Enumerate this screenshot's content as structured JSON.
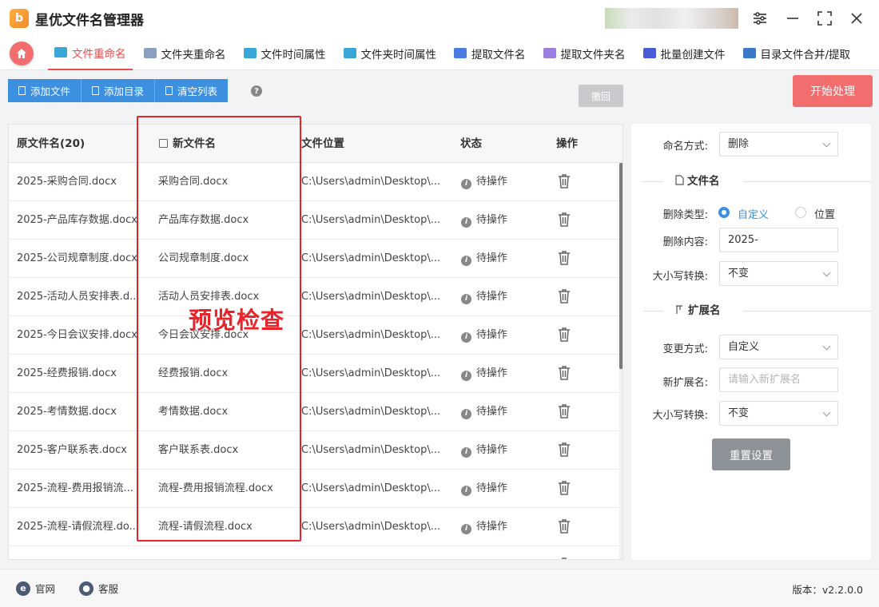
{
  "app": {
    "title": "星优文件名管理器",
    "logo_text": "b"
  },
  "tabs": [
    {
      "label": "文件重命名",
      "color": "#3aa6d8",
      "active": true
    },
    {
      "label": "文件夹重命名",
      "color": "#8aa0bf",
      "active": false
    },
    {
      "label": "文件时间属性",
      "color": "#3aa6d8",
      "active": false
    },
    {
      "label": "文件夹时间属性",
      "color": "#3aa6d8",
      "active": false
    },
    {
      "label": "提取文件名",
      "color": "#4a7be0",
      "active": false
    },
    {
      "label": "提取文件夹名",
      "color": "#9a7ee0",
      "active": false
    },
    {
      "label": "批量创建文件",
      "color": "#4a5bd8",
      "active": false
    },
    {
      "label": "目录文件合并/提取",
      "color": "#3a78c8",
      "active": false
    }
  ],
  "toolbar": {
    "add_file": "添加文件",
    "add_dir": "添加目录",
    "clear_list": "清空列表",
    "help": "?",
    "undo": "撤回",
    "start": "开始处理"
  },
  "table": {
    "headers": {
      "original": "原文件名(20)",
      "new_name": "新文件名",
      "location": "文件位置",
      "status": "状态",
      "action": "操作"
    },
    "rows": [
      {
        "original": "2025-采购合同.docx",
        "new_name": "采购合同.docx",
        "location": "C:\\Users\\admin\\Desktop\\...",
        "status": "待操作"
      },
      {
        "original": "2025-产品库存数据.docx",
        "new_name": "产品库存数据.docx",
        "location": "C:\\Users\\admin\\Desktop\\...",
        "status": "待操作"
      },
      {
        "original": "2025-公司规章制度.docx",
        "new_name": "公司规章制度.docx",
        "location": "C:\\Users\\admin\\Desktop\\...",
        "status": "待操作"
      },
      {
        "original": "2025-活动人员安排表.d...",
        "new_name": "活动人员安排表.docx",
        "location": "C:\\Users\\admin\\Desktop\\...",
        "status": "待操作"
      },
      {
        "original": "2025-今日会议安排.docx",
        "new_name": "今日会议安排.docx",
        "location": "C:\\Users\\admin\\Desktop\\...",
        "status": "待操作"
      },
      {
        "original": "2025-经费报销.docx",
        "new_name": "经费报销.docx",
        "location": "C:\\Users\\admin\\Desktop\\...",
        "status": "待操作"
      },
      {
        "original": "2025-考情数据.docx",
        "new_name": "考情数据.docx",
        "location": "C:\\Users\\admin\\Desktop\\...",
        "status": "待操作"
      },
      {
        "original": "2025-客户联系表.docx",
        "new_name": "客户联系表.docx",
        "location": "C:\\Users\\admin\\Desktop\\...",
        "status": "待操作"
      },
      {
        "original": "2025-流程-费用报销流...",
        "new_name": "流程-费用报销流程.docx",
        "location": "C:\\Users\\admin\\Desktop\\...",
        "status": "待操作"
      },
      {
        "original": "2025-流程-请假流程.do...",
        "new_name": "流程-请假流程.docx",
        "location": "C:\\Users\\admin\\Desktop\\...",
        "status": "待操作"
      }
    ]
  },
  "annotation": "预览检查",
  "side": {
    "naming_mode_label": "命名方式:",
    "naming_mode_value": "删除",
    "filename_section": "文件名",
    "delete_type_label": "删除类型:",
    "delete_type_options": [
      "自定义",
      "位置"
    ],
    "delete_content_label": "删除内容:",
    "delete_content_value": "2025-",
    "case_label": "大小写转换:",
    "case_value": "不变",
    "ext_section": "扩展名",
    "change_mode_label": "变更方式:",
    "change_mode_value": "自定义",
    "new_ext_label": "新扩展名:",
    "new_ext_placeholder": "请输入新扩展名",
    "ext_case_label": "大小写转换:",
    "ext_case_value": "不变",
    "reset": "重置设置"
  },
  "footer": {
    "website": "官网",
    "support": "客服",
    "version": "版本：v2.2.0.0"
  },
  "colors": {
    "accent": "#f26d6d",
    "primary": "#3d8fe0",
    "highlight": "#e8242a"
  }
}
